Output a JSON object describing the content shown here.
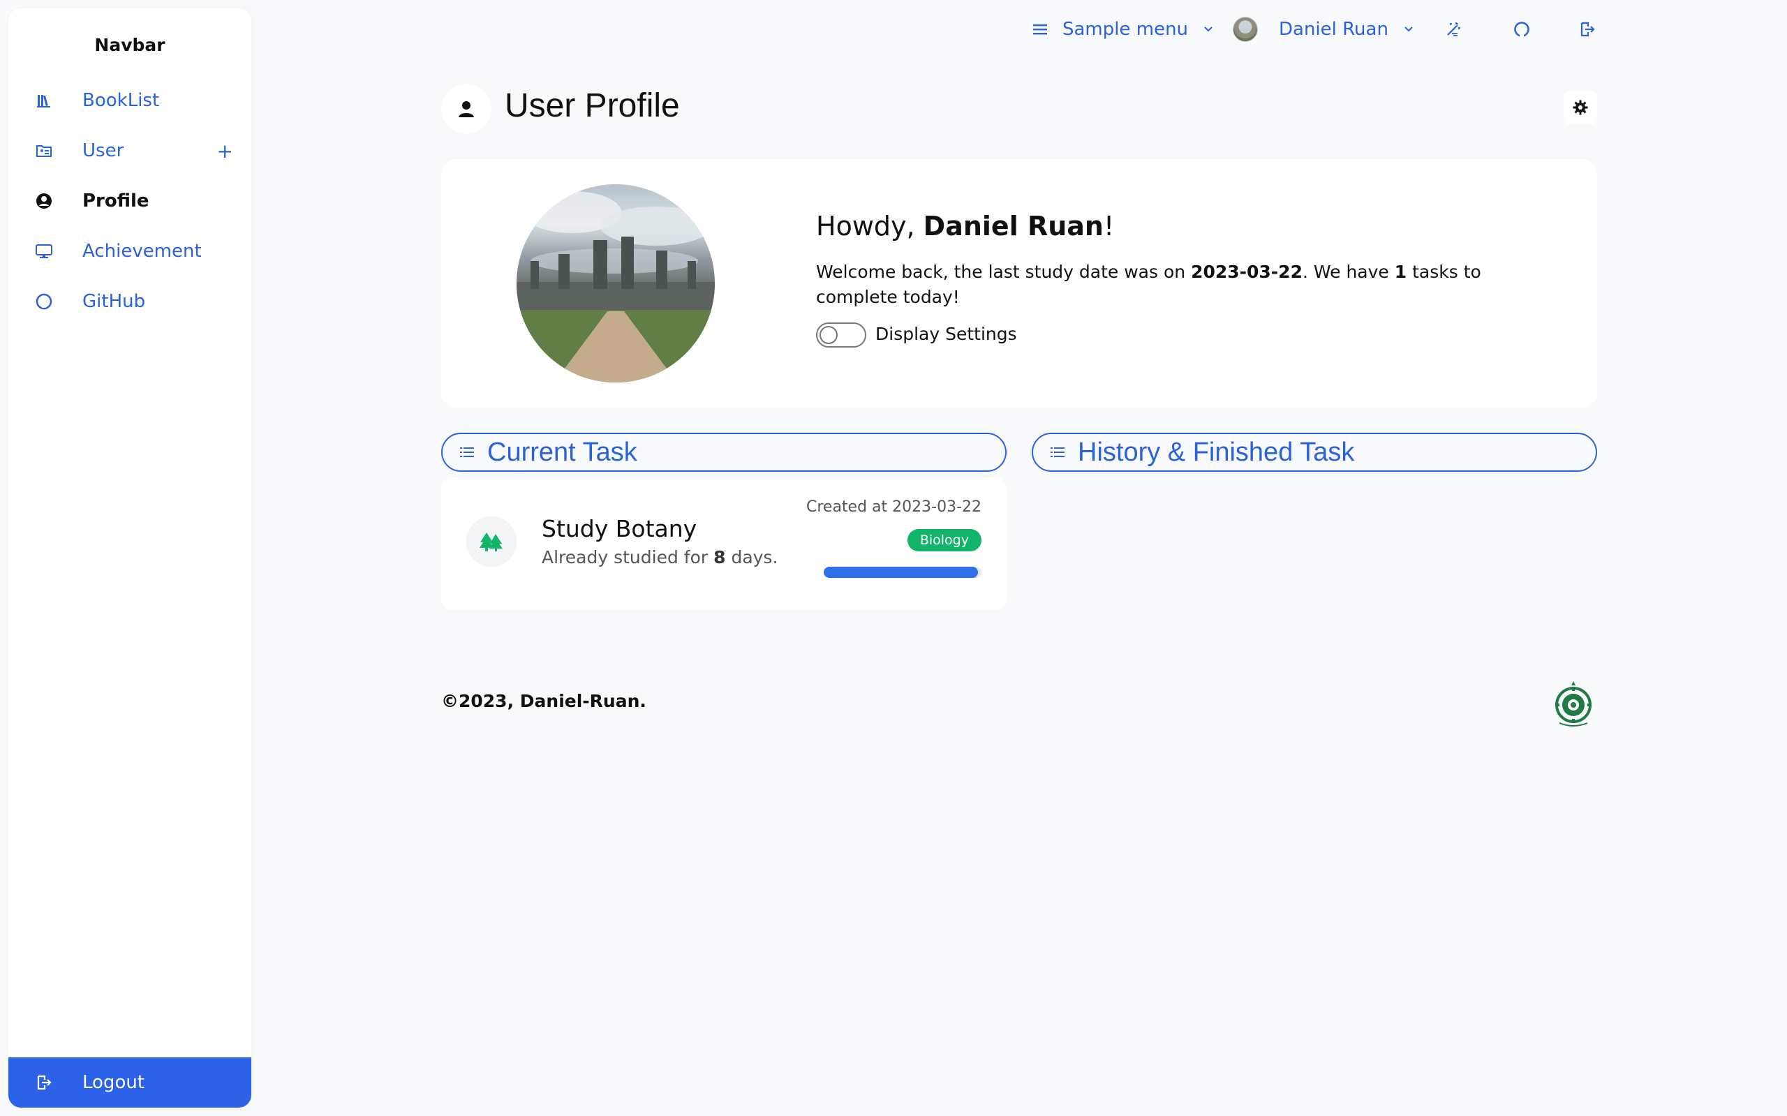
{
  "sidebar": {
    "brand": "Navbar",
    "items": [
      {
        "label": "BookList",
        "icon": "books-icon"
      },
      {
        "label": "User",
        "icon": "folder-user-icon",
        "extra": "+"
      },
      {
        "label": "Profile",
        "icon": "user-circle-icon"
      },
      {
        "label": "Achievement",
        "icon": "monitor-icon"
      },
      {
        "label": "GitHub",
        "icon": "github-icon"
      }
    ],
    "logout_label": "Logout"
  },
  "topbar": {
    "menu_label": "Sample menu",
    "user_name": "Daniel Ruan"
  },
  "header": {
    "title": "User Profile"
  },
  "profile": {
    "greeting": "Howdy, ",
    "name": "Daniel Ruan",
    "greeting_end": "!",
    "welcome_prefix": "Welcome back, the last study date was on ",
    "last_date": "2023-03-22",
    "welcome_mid": ". We have ",
    "task_count": "1",
    "welcome_suffix": " tasks to complete today!",
    "toggle_label": "Display Settings",
    "toggle_on": false
  },
  "tabs": {
    "current": "Current Task",
    "history": "History & Finished Task"
  },
  "task": {
    "title": "Study Botany",
    "sub_prefix": "Already studied for ",
    "days": "8",
    "sub_suffix": " days.",
    "created": "Created at 2023-03-22",
    "tag": "Biology",
    "progress": 0.98
  },
  "footer": {
    "copyright": "©2023, Daniel-Ruan."
  },
  "colors": {
    "accent": "#2c62d9",
    "logout_bg": "#2c62e8",
    "badge": "#12b36a",
    "progress": "#2c6fe8"
  }
}
